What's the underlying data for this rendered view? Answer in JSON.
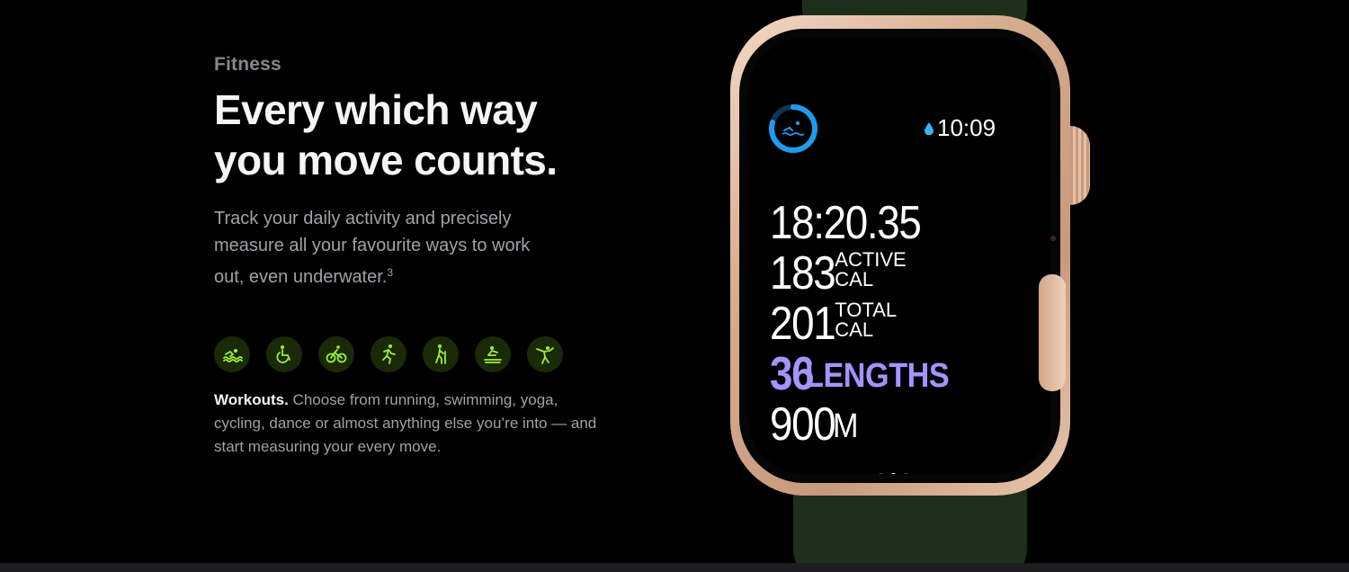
{
  "section": {
    "eyebrow": "Fitness",
    "headline_line1": "Every which way",
    "headline_line2": "you move counts.",
    "body": "Track your daily activity and precisely measure all your favourite ways to work out, even underwater.",
    "footnote": "3"
  },
  "workout_icons": [
    {
      "name": "swimming-icon"
    },
    {
      "name": "wheelchair-icon"
    },
    {
      "name": "cycling-icon"
    },
    {
      "name": "running-icon"
    },
    {
      "name": "hiking-icon"
    },
    {
      "name": "rowing-icon"
    },
    {
      "name": "dance-icon"
    }
  ],
  "workouts": {
    "lead": "Workouts.",
    "text": " Choose from running, swimming, yoga, cycling, dance or almost anything else you’re into — and start measuring your every move."
  },
  "watch": {
    "time": "10:09",
    "duration": "18:20.35",
    "active_value": "183",
    "active_label_top": "ACTIVE",
    "active_label_bottom": "CAL",
    "total_value": "201",
    "total_label_top": "TOTAL",
    "total_label_bottom": "CAL",
    "lengths_value": "36",
    "lengths_unit": "LENGTHS",
    "distance_value": "900",
    "distance_unit": "M",
    "page_dots": 3,
    "active_page": 2
  },
  "colors": {
    "background": "#000000",
    "eyebrow": "#86868b",
    "headline": "#f5f5f7",
    "body": "#a1a1a6",
    "icon_green": "#9cf034",
    "lengths_purple": "#a593ff",
    "ring_blue": "#1e9bf0"
  }
}
